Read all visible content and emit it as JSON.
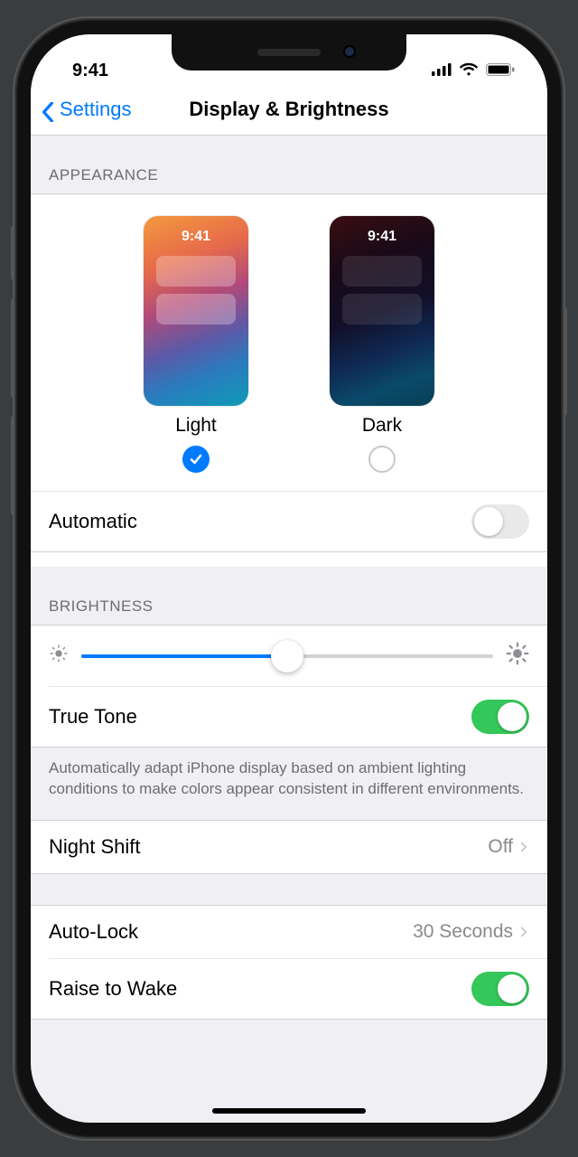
{
  "status": {
    "time": "9:41"
  },
  "nav": {
    "back": "Settings",
    "title": "Display & Brightness"
  },
  "appearance": {
    "header": "APPEARANCE",
    "light_label": "Light",
    "dark_label": "Dark",
    "preview_time": "9:41",
    "automatic_label": "Automatic",
    "automatic_on": false,
    "selected": "light"
  },
  "brightness": {
    "header": "BRIGHTNESS",
    "value_percent": 50,
    "true_tone_label": "True Tone",
    "true_tone_on": true,
    "description": "Automatically adapt iPhone display based on ambient lighting conditions to make colors appear consistent in different environments."
  },
  "night_shift": {
    "label": "Night Shift",
    "value": "Off"
  },
  "auto_lock": {
    "label": "Auto-Lock",
    "value": "30 Seconds"
  },
  "raise_to_wake": {
    "label": "Raise to Wake",
    "on": true
  }
}
